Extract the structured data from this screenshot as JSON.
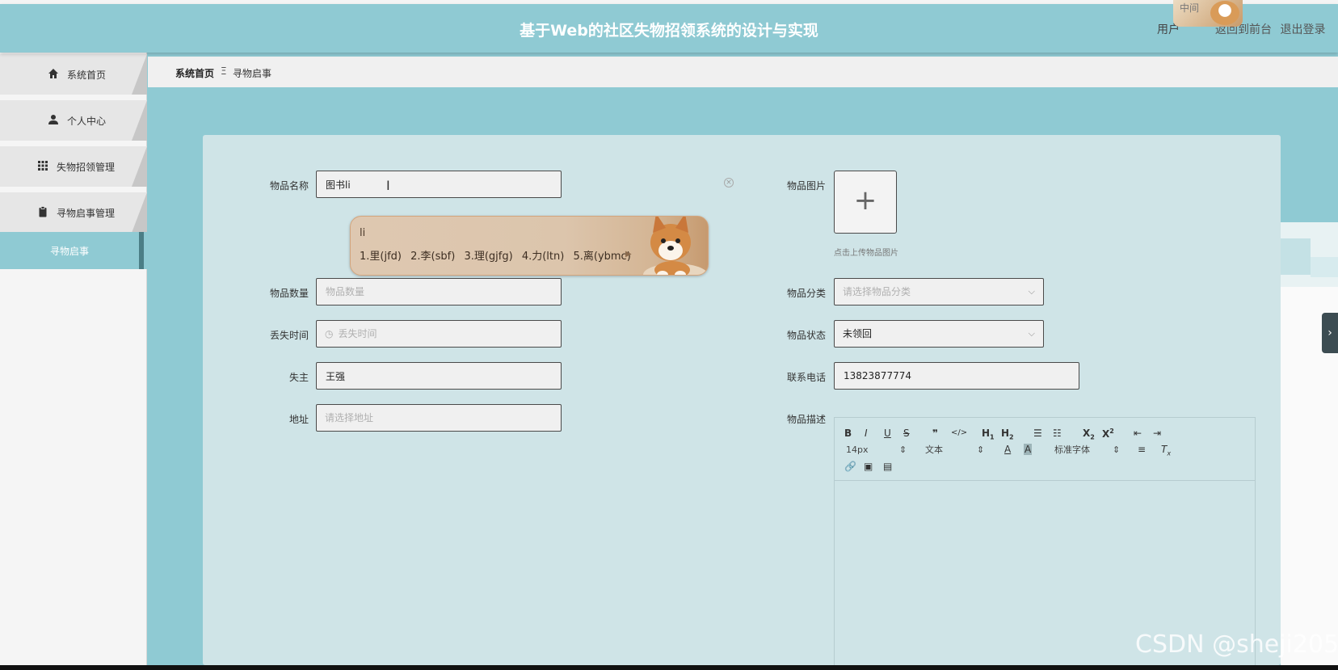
{
  "header": {
    "title": "基于Web的社区失物招领系统的设计与实现",
    "user_text": "用户",
    "links": [
      "返回到前台",
      "退出登录"
    ],
    "avatar_text": "中间"
  },
  "sidebar": {
    "items": [
      {
        "label": "系统首页",
        "icon": "home-icon"
      },
      {
        "label": "个人中心",
        "icon": "user-icon"
      },
      {
        "label": "失物招领管理",
        "icon": "grid-icon"
      },
      {
        "label": "寻物启事管理",
        "icon": "clipboard-icon"
      },
      {
        "label": "寻物启事",
        "icon": ""
      }
    ],
    "active_index": 4
  },
  "breadcrumb": {
    "home": "系统首页",
    "separator": "Ξ",
    "current": "寻物启事"
  },
  "form": {
    "name_label": "物品名称",
    "name_value": "图书li",
    "image_label": "物品图片",
    "upload_tip": "点击上传物品图片",
    "quantity_label": "物品数量",
    "quantity_placeholder": "物品数量",
    "category_label": "物品分类",
    "category_placeholder": "请选择物品分类",
    "lost_time_label": "丢失时间",
    "lost_time_placeholder": "丢失时间",
    "status_label": "物品状态",
    "status_value": "未领回",
    "owner_label": "失主",
    "owner_value": "王强",
    "phone_label": "联系电话",
    "phone_value": "13823877774",
    "address_label": "地址",
    "address_placeholder": "请选择地址",
    "desc_label": "物品描述"
  },
  "editor": {
    "font_size": "14px",
    "text_type": "文本",
    "font_family": "标准字体"
  },
  "ime": {
    "composition": "li",
    "candidates": [
      "1.里(jfd)",
      "2.李(sbf)",
      "3.理(gjfg)",
      "4.力(ltn)",
      "5.离(ybmc)"
    ]
  },
  "watermark": "CSDN @sheji205",
  "colors": {
    "primary": "#8fcad3",
    "panel": "#cfe4e7",
    "active_edge": "#4b7e86"
  }
}
